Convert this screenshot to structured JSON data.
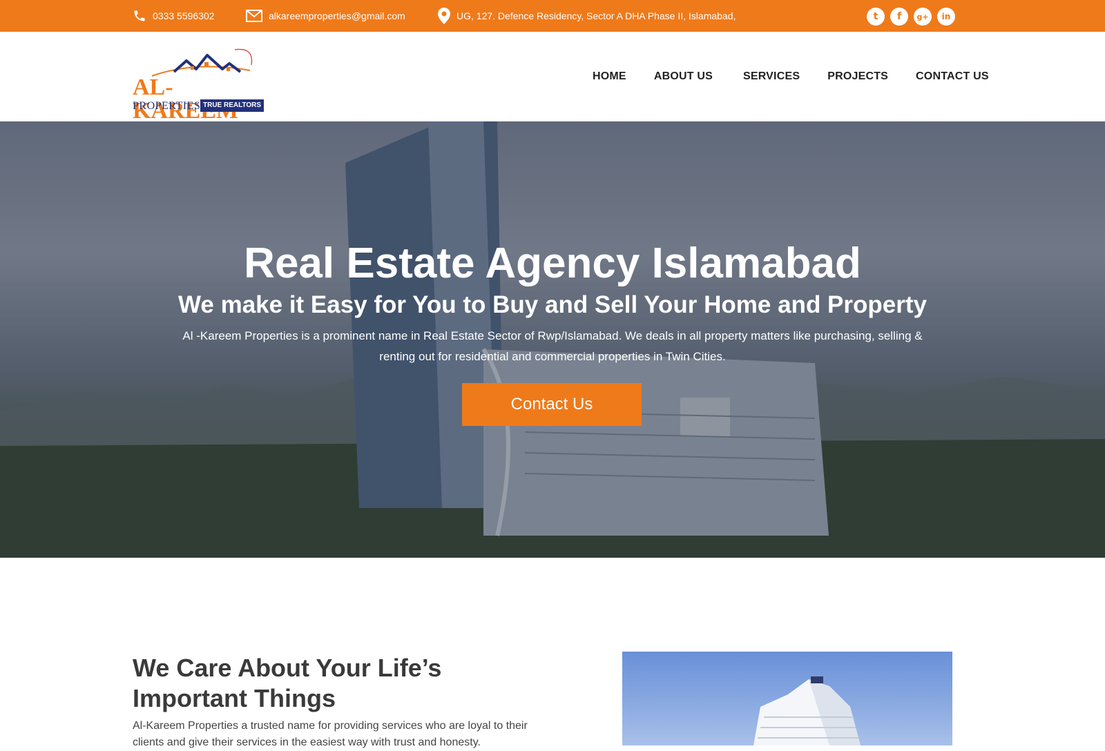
{
  "topbar": {
    "phone": "0333 5596302",
    "email": "alkareemproperties@gmail.com",
    "address": "UG, 127. Defence Residency, Sector A DHA Phase II, Islamabad,",
    "socials": [
      {
        "name": "twitter",
        "glyph": "t"
      },
      {
        "name": "facebook",
        "glyph": "f"
      },
      {
        "name": "google-plus",
        "glyph": "g+"
      },
      {
        "name": "linkedin",
        "glyph": "in"
      }
    ],
    "accent": "#ef7a1a"
  },
  "logo": {
    "name": "AL-KAREEM",
    "sub": "PROPERTIES",
    "badge": "TRUE REALTORS"
  },
  "nav": {
    "items": [
      "HOME",
      "ABOUT US",
      "SERVICES",
      "PROJECTS",
      "CONTACT US"
    ]
  },
  "hero": {
    "title": "Real Estate Agency Islamabad",
    "subtitle": "We make it Easy for You to Buy and Sell Your Home and Property",
    "description": "Al -Kareem Properties is a prominent name in Real Estate Sector of Rwp/Islamabad. We deals in all property matters like purchasing, selling & renting out for residential and commercial properties in Twin Cities.",
    "button": "Contact Us"
  },
  "about": {
    "title": "We Care About Your Life’s Important Things",
    "text": "Al-Kareem Properties a trusted name for providing services who are loyal to their clients and give their services in the easiest way with trust and honesty."
  },
  "colors": {
    "brand_orange": "#ef7a1a",
    "brand_navy": "#23317a"
  }
}
